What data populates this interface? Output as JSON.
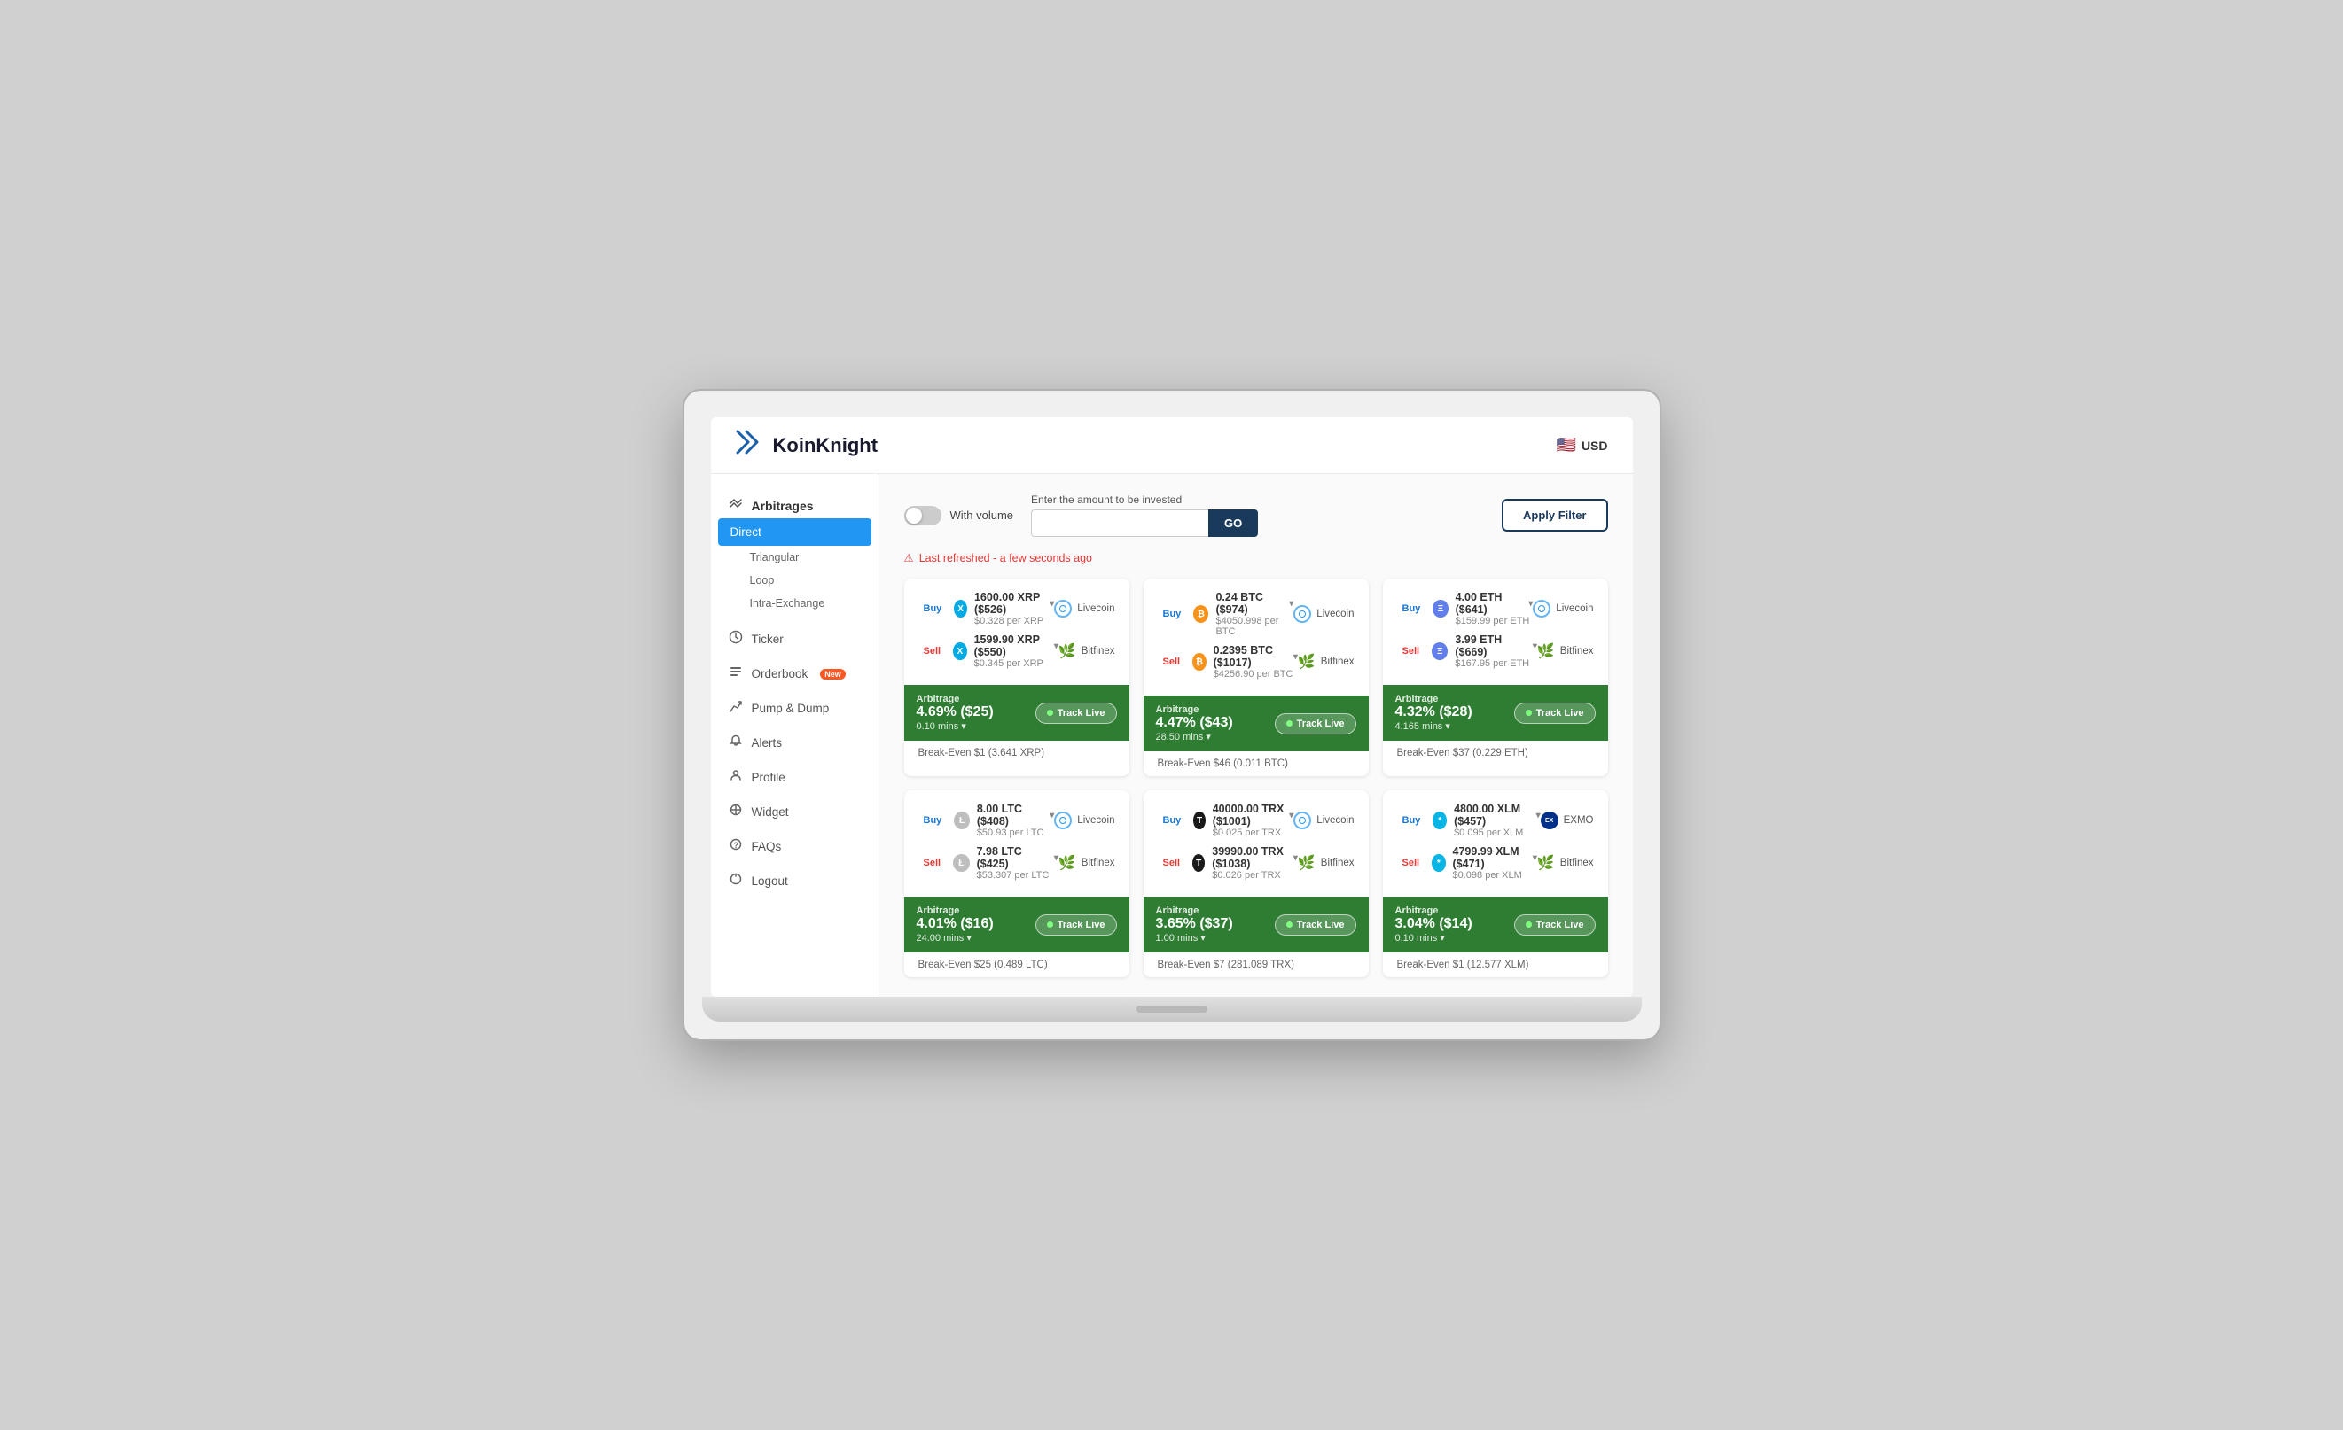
{
  "header": {
    "logo_text": "KoinKnight",
    "currency": "USD",
    "flag": "🇺🇸"
  },
  "sidebar": {
    "arbitrages_label": "Arbitrages",
    "items": [
      {
        "id": "direct",
        "label": "Direct",
        "active": true
      },
      {
        "id": "triangular",
        "label": "Triangular",
        "sub": true
      },
      {
        "id": "loop",
        "label": "Loop",
        "sub": true
      },
      {
        "id": "intra-exchange",
        "label": "Intra-Exchange",
        "sub": true
      },
      {
        "id": "ticker",
        "label": "Ticker",
        "icon": "⏱"
      },
      {
        "id": "orderbook",
        "label": "Orderbook",
        "icon": "📋",
        "badge": "New"
      },
      {
        "id": "pump-dump",
        "label": "Pump & Dump",
        "icon": "⚡"
      },
      {
        "id": "alerts",
        "label": "Alerts",
        "icon": "🔔"
      },
      {
        "id": "profile",
        "label": "Profile",
        "icon": "👤"
      },
      {
        "id": "widget",
        "label": "Widget",
        "icon": "⊕"
      },
      {
        "id": "faqs",
        "label": "FAQs",
        "icon": "❓"
      },
      {
        "id": "logout",
        "label": "Logout",
        "icon": "⏻"
      }
    ]
  },
  "toolbar": {
    "toggle_label": "With volume",
    "invest_label": "Enter the amount to be invested",
    "invest_placeholder": "",
    "go_label": "GO",
    "apply_filter_label": "Apply Filter"
  },
  "refresh": {
    "text": "Last refreshed - a few seconds ago"
  },
  "cards": [
    {
      "buy": {
        "type": "Buy",
        "coin": "XRP",
        "coin_color": "xrp",
        "amount": "1600.00 XRP ($526)",
        "price": "$0.328 per XRP",
        "exchange": "Livecoin",
        "exchange_type": "livecoin"
      },
      "sell": {
        "type": "Sell",
        "coin": "XRP",
        "coin_color": "xrp",
        "amount": "1599.90 XRP ($550)",
        "price": "$0.345 per XRP",
        "exchange": "Bitfinex",
        "exchange_type": "bitfinex"
      },
      "arbitrage": {
        "percent": "4.69% ($25)",
        "time": "0.10 mins",
        "track_label": "Track Live"
      },
      "break_even": "Break-Even $1 (3.641 XRP)"
    },
    {
      "buy": {
        "type": "Buy",
        "coin": "BTC",
        "coin_color": "btc",
        "amount": "0.24 BTC ($974)",
        "price": "$4050.998 per BTC",
        "exchange": "Livecoin",
        "exchange_type": "livecoin"
      },
      "sell": {
        "type": "Sell",
        "coin": "BTC",
        "coin_color": "btc",
        "amount": "0.2395 BTC ($1017)",
        "price": "$4256.90 per BTC",
        "exchange": "Bitfinex",
        "exchange_type": "bitfinex"
      },
      "arbitrage": {
        "percent": "4.47% ($43)",
        "time": "28.50 mins",
        "track_label": "Track Live"
      },
      "break_even": "Break-Even $46 (0.011 BTC)"
    },
    {
      "buy": {
        "type": "Buy",
        "coin": "ETH",
        "coin_color": "eth",
        "amount": "4.00 ETH ($641)",
        "price": "$159.99 per ETH",
        "exchange": "Livecoin",
        "exchange_type": "livecoin"
      },
      "sell": {
        "type": "Sell",
        "coin": "ETH",
        "coin_color": "eth",
        "amount": "3.99 ETH ($669)",
        "price": "$167.95 per ETH",
        "exchange": "Bitfinex",
        "exchange_type": "bitfinex"
      },
      "arbitrage": {
        "percent": "4.32% ($28)",
        "time": "4.165 mins",
        "track_label": "Track Live"
      },
      "break_even": "Break-Even $37 (0.229 ETH)"
    },
    {
      "buy": {
        "type": "Buy",
        "coin": "LTC",
        "coin_color": "ltc",
        "amount": "8.00 LTC ($408)",
        "price": "$50.93 per LTC",
        "exchange": "Livecoin",
        "exchange_type": "livecoin"
      },
      "sell": {
        "type": "Sell",
        "coin": "LTC",
        "coin_color": "ltc",
        "amount": "7.98 LTC ($425)",
        "price": "$53.307 per LTC",
        "exchange": "Bitfinex",
        "exchange_type": "bitfinex"
      },
      "arbitrage": {
        "percent": "4.01% ($16)",
        "time": "24.00 mins",
        "track_label": "Track Live"
      },
      "break_even": "Break-Even $25 (0.489 LTC)"
    },
    {
      "buy": {
        "type": "Buy",
        "coin": "TRX",
        "coin_color": "trx",
        "amount": "40000.00 TRX ($1001)",
        "price": "$0.025 per TRX",
        "exchange": "Livecoin",
        "exchange_type": "livecoin"
      },
      "sell": {
        "type": "Sell",
        "coin": "TRX",
        "coin_color": "trx",
        "amount": "39990.00 TRX ($1038)",
        "price": "$0.026 per TRX",
        "exchange": "Bitfinex",
        "exchange_type": "bitfinex"
      },
      "arbitrage": {
        "percent": "3.65% ($37)",
        "time": "1.00 mins",
        "track_label": "Track Live"
      },
      "break_even": "Break-Even $7 (281.089 TRX)"
    },
    {
      "buy": {
        "type": "Buy",
        "coin": "XLM",
        "coin_color": "xlm",
        "amount": "4800.00 XLM ($457)",
        "price": "$0.095 per XLM",
        "exchange": "EXMO",
        "exchange_type": "exmo"
      },
      "sell": {
        "type": "Sell",
        "coin": "XLM",
        "coin_color": "xlm",
        "amount": "4799.99 XLM ($471)",
        "price": "$0.098 per XLM",
        "exchange": "Bitfinex",
        "exchange_type": "bitfinex"
      },
      "arbitrage": {
        "percent": "3.04% ($14)",
        "time": "0.10 mins",
        "track_label": "Track Live"
      },
      "break_even": "Break-Even $1 (12.577 XLM)"
    }
  ]
}
